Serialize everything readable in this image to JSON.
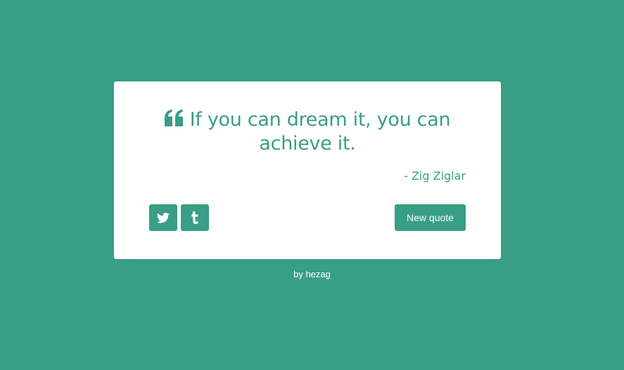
{
  "theme": {
    "accent": "#389e85",
    "card_background": "#ffffff",
    "button_text": "#ffffff"
  },
  "quote": {
    "icon": "quote-left-icon",
    "text": "If you can dream it, you can achieve it.",
    "author": "- Zig Ziglar"
  },
  "actions": {
    "twitter_icon": "twitter-icon",
    "tumblr_icon": "tumblr-icon",
    "new_quote_label": "New quote"
  },
  "footer": {
    "prefix": "by ",
    "author_link": "hezag"
  }
}
